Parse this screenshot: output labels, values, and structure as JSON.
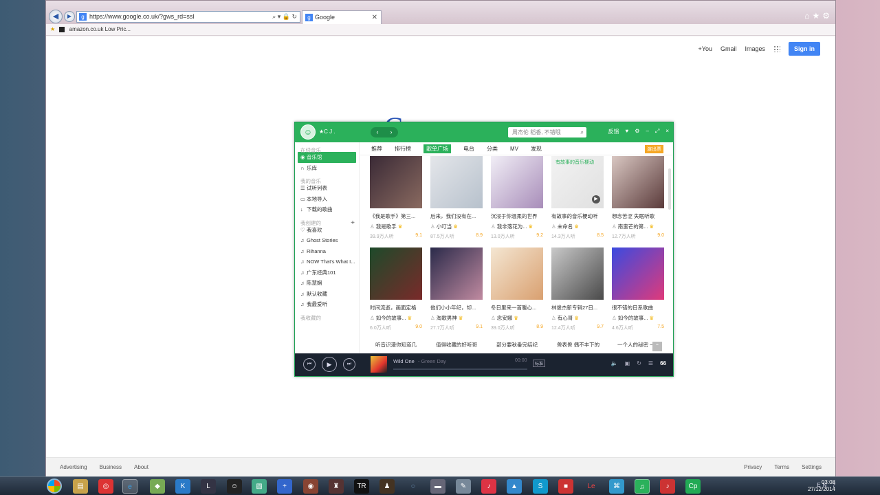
{
  "browser": {
    "url": "https://www.google.co.uk/?gws_rd=ssl",
    "tab_title": "Google",
    "favorite": "amazon.co.uk Low Pric..."
  },
  "google": {
    "links": [
      "+You",
      "Gmail",
      "Images"
    ],
    "signin": "Sign in",
    "footer_left": [
      "Advertising",
      "Business",
      "About"
    ],
    "footer_right": [
      "Privacy",
      "Terms",
      "Settings"
    ]
  },
  "qq": {
    "username": "★C J .",
    "search_placeholder": "周杰伦 稻香, 不错哦",
    "top_controls": [
      "反馈",
      "♥",
      "⚙",
      "–",
      "⤢",
      "×"
    ],
    "sidebar": {
      "sec_online": "在线音乐",
      "item_music_hall": "音乐馆",
      "item_library": "乐库",
      "sec_my": "我的音乐",
      "item_trial_list": "试听列表",
      "item_local_import": "本地导入",
      "item_downloads": "下载的歌曲",
      "sec_created": "我创建的",
      "playlists": [
        "我喜欢",
        "Ghost Stories",
        "Rihanna",
        "NOW That's What I...",
        "广东经典101",
        "陈慧娴",
        "默认收藏",
        "我最爱听"
      ],
      "sec_collected": "我收藏的"
    },
    "tabs": [
      "推荐",
      "排行榜",
      "歌单广场",
      "电台",
      "分类",
      "MV",
      "发现"
    ],
    "concert_badge": "演出票",
    "cards": [
      {
        "title": "《我是歌手》第三...",
        "user": "我是歌手",
        "listens": "39.9万人听",
        "score": "9.1",
        "color1": "#3a2a36",
        "color2": "#8a6a60"
      },
      {
        "title": "后来，我们没有在...",
        "user": "小叮当",
        "listens": "87.5万人听",
        "score": "8.9",
        "color1": "#e4e6ea",
        "color2": "#b7c1cc"
      },
      {
        "title": "沉浸于你温柔的世界",
        "user": "我非落花为...",
        "listens": "13.0万人听",
        "score": "9.2",
        "color1": "#f1eef6",
        "color2": "#a88db9"
      },
      {
        "title": "有故事的音乐梗动听",
        "user": "未命名",
        "listens": "14.3万人听",
        "score": "8.5",
        "color1": "#f2f2f2",
        "color2": "#e0e0e0",
        "overlay": "有故事的音乐梗动"
      },
      {
        "title": "想念苦涩 失眠听歌",
        "user": "南蛮芒的第...",
        "listens": "12.7万人听",
        "score": "9.0",
        "color1": "#d9c7c2",
        "color2": "#5a3a3a"
      },
      {
        "title": "时间流逝，画面定格",
        "user": "如今的故事...",
        "listens": "6.0万人听",
        "score": "9.0",
        "color1": "#1d4a2a",
        "color2": "#7a2a2a"
      },
      {
        "title": "他们小小年纪，却...",
        "user": "淘歌男神",
        "listens": "27.7万人听",
        "score": "9.1",
        "color1": "#2a2a4a",
        "color2": "#c08aa0"
      },
      {
        "title": "冬日里来一首暖心...",
        "user": "念安娜",
        "listens": "39.0万人听",
        "score": "8.9",
        "color1": "#f4e6d2",
        "color2": "#d9a070"
      },
      {
        "title": "林俊杰新专辑27日...",
        "user": "有心哥",
        "listens": "12.4万人听",
        "score": "9.7",
        "color1": "#c9c9c9",
        "color2": "#4a4a4a"
      },
      {
        "title": "很不错的日系歌曲",
        "user": "如今的故事...",
        "listens": "4.6万人听",
        "score": "7.5",
        "color1": "#3a4ae0",
        "color2": "#e03a7a"
      }
    ],
    "lyric_row": [
      "听音识漫你知道几",
      "值得收藏的好听哥",
      "部分要秋番完结纪",
      "兽表兽 偶不丰下的",
      "一个人的秘密 一个"
    ],
    "player": {
      "song": "Wild One",
      "artist": "Green Day",
      "time": "00:00",
      "quality": "标准",
      "playlist_count": "66",
      "progress": 0.0
    }
  },
  "taskbar": {
    "clock_time": "03:08",
    "clock_date": "27/12/2014",
    "tray": "EN ?"
  }
}
